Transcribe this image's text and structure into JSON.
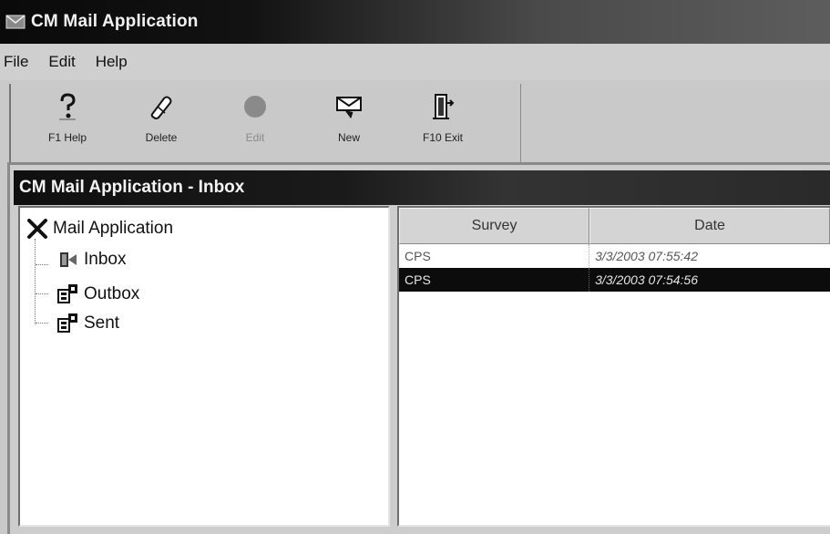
{
  "window": {
    "title": "CM Mail Application"
  },
  "menu": {
    "items": [
      "File",
      "Edit",
      "Help"
    ]
  },
  "toolbar": {
    "buttons": [
      {
        "label": "F1 Help",
        "icon": "help-icon",
        "enabled": true
      },
      {
        "label": "Delete",
        "icon": "delete-icon",
        "enabled": true
      },
      {
        "label": "Edit",
        "icon": "edit-icon",
        "enabled": false
      },
      {
        "label": "New",
        "icon": "new-icon",
        "enabled": true
      },
      {
        "label": "F10 Exit",
        "icon": "exit-icon",
        "enabled": true
      }
    ]
  },
  "inner_window": {
    "title": "CM Mail Application - Inbox"
  },
  "tree": {
    "root": {
      "label": "Mail Application",
      "icon": "close-x-icon"
    },
    "children": [
      {
        "label": "Inbox",
        "icon": "inbox-icon"
      },
      {
        "label": "Outbox",
        "icon": "outbox-icon"
      },
      {
        "label": "Sent",
        "icon": "sent-icon"
      }
    ]
  },
  "list": {
    "columns": [
      "Survey",
      "Date"
    ],
    "rows": [
      {
        "survey": "CPS",
        "date": "3/3/2003 07:55:42",
        "selected": false
      },
      {
        "survey": "CPS",
        "date": "3/3/2003 07:54:56",
        "selected": true
      }
    ]
  }
}
